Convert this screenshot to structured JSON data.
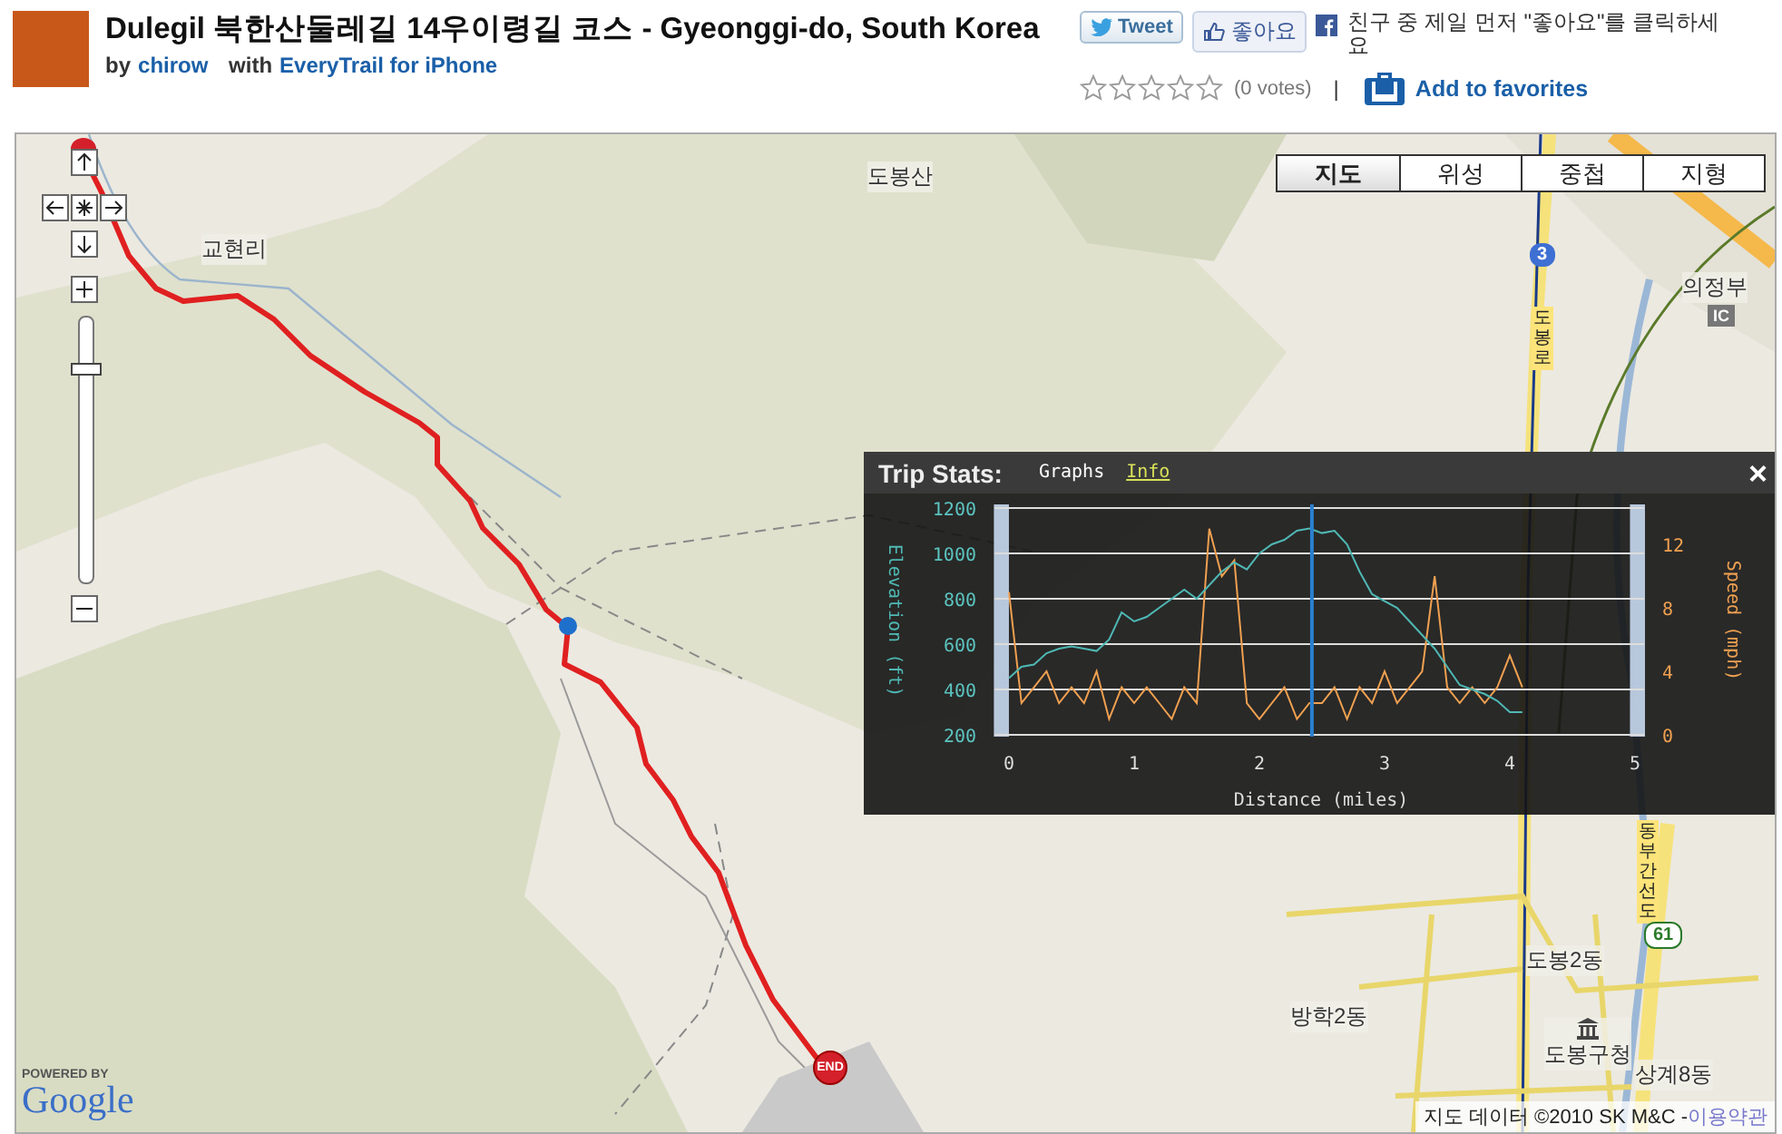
{
  "header": {
    "title": "Dulegil 북한산둘레길 14우이령길 코스 - Gyeonggi-do, South Korea",
    "by_label": "by",
    "author": "chirow",
    "with_label": "with",
    "app_link": "EveryTrail for iPhone",
    "tweet_button": "Tweet",
    "like_button": "좋아요",
    "like_prompt": "친구 중 제일 먼저 \"좋아요\"를 클릭하세요",
    "stars": 0,
    "votes": "(0 votes)",
    "separator": "|",
    "favorites_link": "Add to favorites"
  },
  "map": {
    "zoom_slider": {
      "level": 0.82
    },
    "map_types": [
      {
        "label": "지도",
        "selected": true
      },
      {
        "label": "위성",
        "selected": false
      },
      {
        "label": "중첩",
        "selected": false
      },
      {
        "label": "지형",
        "selected": false
      }
    ],
    "labels": [
      {
        "text": "교현리",
        "kind": "place"
      },
      {
        "text": "도봉산",
        "kind": "place"
      },
      {
        "text": "의정부",
        "kind": "place"
      },
      {
        "text": "도봉로",
        "kind": "road"
      },
      {
        "text": "동부간선도",
        "kind": "road"
      },
      {
        "text": "도봉2동",
        "kind": "place"
      },
      {
        "text": "도봉구청",
        "kind": "office"
      },
      {
        "text": "상계8동",
        "kind": "place"
      },
      {
        "text": "방학2동",
        "kind": "place"
      }
    ],
    "route_shields": [
      {
        "text": "3",
        "kind": "national"
      },
      {
        "text": "61",
        "kind": "state"
      }
    ],
    "ic_badge": "IC",
    "end_marker": "END",
    "powered_by": "POWERED BY",
    "logo": "Google",
    "copyright": "지도 데이터 ©2010 SK M&C - ",
    "terms_link": "이용약관"
  },
  "trip_stats": {
    "title": "Trip Stats:",
    "tabs": [
      {
        "label": "Graphs",
        "selected": true
      },
      {
        "label": "Info",
        "selected": false
      }
    ],
    "close": "×",
    "chart_data": {
      "type": "line",
      "xlabel": "Distance (miles)",
      "grid": true,
      "x": [
        0,
        0.1,
        0.2,
        0.3,
        0.4,
        0.5,
        0.6,
        0.7,
        0.8,
        0.9,
        1,
        1.1,
        1.2,
        1.3,
        1.4,
        1.5,
        1.6,
        1.7,
        1.8,
        1.9,
        2,
        2.1,
        2.2,
        2.3,
        2.4,
        2.5,
        2.6,
        2.7,
        2.8,
        2.9,
        3,
        3.1,
        3.2,
        3.3,
        3.4,
        3.5,
        3.6,
        3.7,
        3.8,
        3.9,
        4,
        4.1
      ],
      "series": [
        {
          "name": "Elevation (ft)",
          "color": "#4fb8b4",
          "values": [
            450,
            500,
            510,
            560,
            580,
            590,
            580,
            570,
            620,
            740,
            700,
            720,
            760,
            800,
            840,
            800,
            860,
            920,
            960,
            930,
            1000,
            1040,
            1060,
            1100,
            1110,
            1090,
            1100,
            1040,
            920,
            820,
            790,
            760,
            700,
            640,
            580,
            500,
            420,
            400,
            380,
            350,
            300,
            300
          ]
        },
        {
          "name": "Speed (mph)",
          "color": "#f0a050",
          "axis": "y2",
          "values": [
            9,
            2,
            3,
            4,
            2,
            3,
            2,
            4,
            1,
            3,
            2,
            3,
            2,
            1,
            3,
            2,
            13,
            10,
            11,
            2,
            1,
            2,
            3,
            1,
            2,
            2,
            3,
            1,
            3,
            2,
            4,
            2,
            3,
            4,
            10,
            3,
            2,
            3,
            2,
            3,
            5,
            3
          ]
        }
      ],
      "ref_lines": [
        {
          "axis": "x",
          "value": 2.42
        }
      ],
      "bands": [
        {
          "axis": "x",
          "from": -0.12,
          "to": 0
        },
        {
          "axis": "x",
          "from": 4.96,
          "to": 5.08
        }
      ],
      "xlim": [
        -0.12,
        5.08
      ],
      "ylim": [
        200,
        1200
      ],
      "xticks": [
        0,
        1,
        2,
        3,
        4,
        5
      ],
      "yticks": [
        200,
        400,
        600,
        800,
        1000,
        1200
      ],
      "y2lim": [
        0,
        14.3
      ],
      "y2ticks": [
        0,
        4,
        8,
        12
      ]
    }
  }
}
